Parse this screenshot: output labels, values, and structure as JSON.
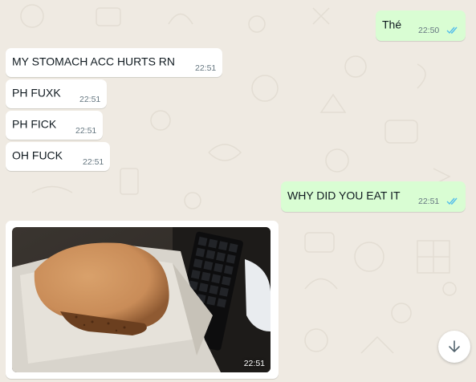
{
  "colors": {
    "chat_background": "#efeae2",
    "incoming_bubble": "#ffffff",
    "outgoing_bubble": "#d9fdd3",
    "read_tick": "#53bdeb",
    "timestamp": "#667781"
  },
  "messages": [
    {
      "direction": "outgoing",
      "text": "Thé",
      "time": "22:50",
      "status_icon": "double-check-read-icon"
    },
    {
      "direction": "incoming",
      "text": "MY STOMACH ACC HURTS RN",
      "time": "22:51"
    },
    {
      "direction": "incoming",
      "text": "PH FUXK",
      "time": "22:51"
    },
    {
      "direction": "incoming",
      "text": "PH FICK",
      "time": "22:51"
    },
    {
      "direction": "incoming",
      "text": "OH FUCK",
      "time": "22:51"
    },
    {
      "direction": "outgoing",
      "text": "WHY DID YOU EAT IT",
      "time": "22:51",
      "status_icon": "double-check-read-icon"
    },
    {
      "direction": "incoming",
      "type": "image",
      "image_subject": "food-photo",
      "time": "22:51"
    }
  ],
  "scroll_button": {
    "icon": "arrow-down-icon"
  }
}
